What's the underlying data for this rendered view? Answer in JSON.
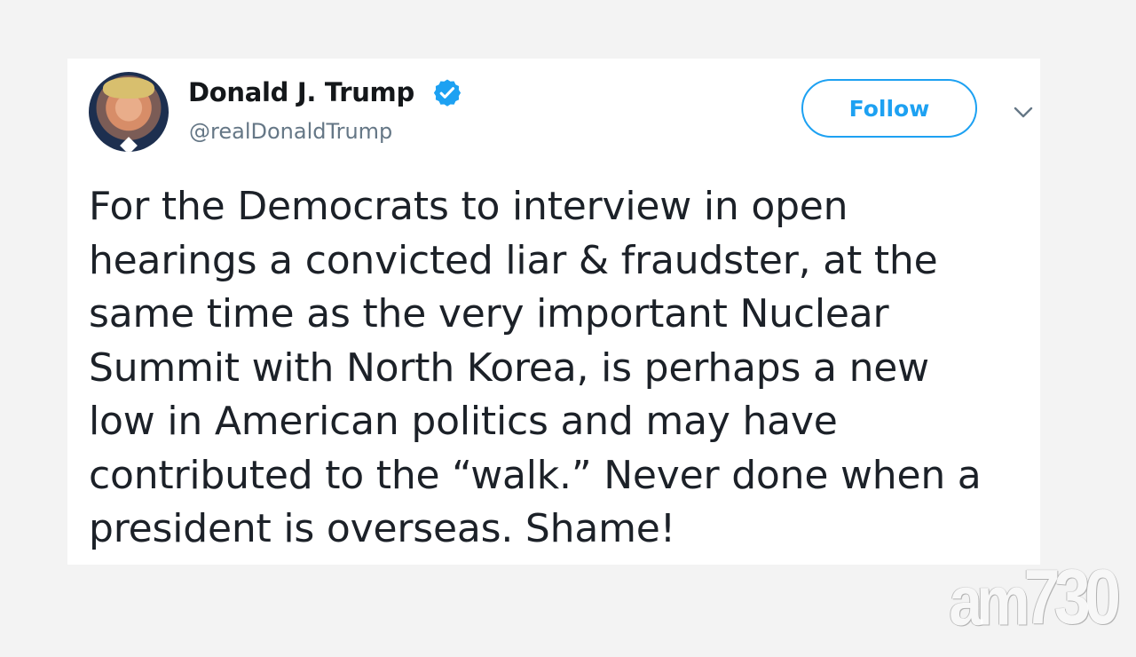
{
  "author": {
    "name": "Donald J. Trump",
    "handle": "@realDonaldTrump",
    "verified": true,
    "avatar_icon": "user-avatar-icon"
  },
  "actions": {
    "follow_label": "Follow",
    "menu_icon": "chevron-down-icon"
  },
  "tweet": {
    "text": "For the Democrats to interview in open\nhearings a convicted liar & fraudster, at the\nsame time as the very important Nuclear\nSummit with North Korea, is perhaps a new\nlow in American politics and may have\ncontributed to the “walk.” Never done when a\npresident is overseas. Shame!"
  },
  "watermark": {
    "letters": "am",
    "digits": "730"
  },
  "colors": {
    "background": "#f3f3f3",
    "card": "#ffffff",
    "accent": "#1da1f2",
    "text": "#14171a",
    "muted": "#657786"
  }
}
